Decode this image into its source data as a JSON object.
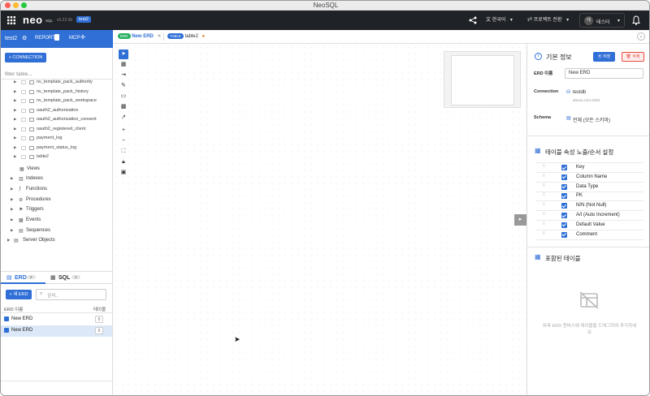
{
  "window": {
    "title": "NeoSQL"
  },
  "appbar": {
    "logo": "neo",
    "logo_sub": "SQL",
    "version": "v0.22.0b",
    "project_badge": "test2",
    "language_label": "한국어",
    "project_switch_label": "프로젝트 전환",
    "avatar_initial": "테",
    "user_name": "테스터"
  },
  "sidebar": {
    "project_name": "test2",
    "report_label": "REPORT",
    "mcp_label": "MCP",
    "connection_button": "CONNECTION",
    "filter_placeholder": "filter table...",
    "tables": [
      "nv_template_pack_authority",
      "nv_template_pack_history",
      "nv_template_pack_workspace",
      "oauth2_authorization",
      "oauth2_authorization_consent",
      "oauth2_registered_client",
      "payment_log",
      "payment_status_log",
      "table2"
    ],
    "groups": [
      "Views",
      "Indexes",
      "Functions",
      "Procedures",
      "Triggers",
      "Events",
      "Sequences"
    ],
    "server_objects": "Server Objects",
    "tabs": {
      "erd_label": "ERD",
      "erd_count": "2",
      "sql_label": "SQL",
      "sql_count": "1"
    },
    "new_erd_button": "+ 새 ERD",
    "search_placeholder": "검색...",
    "list_header": {
      "name": "ERD 이름",
      "tables": "테이블"
    },
    "erd_list": [
      {
        "name": "New ERD",
        "tables": "0"
      },
      {
        "name": "New ERD",
        "tables": "0"
      }
    ]
  },
  "main": {
    "tabs": [
      {
        "badge": "ERD",
        "label": "New ERD",
        "badge_color": "#27ae60"
      },
      {
        "badge": "TABLE",
        "label": "table2",
        "badge_color": "#2f6fd6"
      }
    ]
  },
  "panel": {
    "basic_info_title": "기본 정보",
    "save_button": "저장",
    "delete_button": "삭제",
    "erd_name_label": "ERD 이름",
    "erd_name_value": "New ERD",
    "connection_label": "Connection",
    "connection_name": "testdb",
    "connection_host": "ahnus.com:3360",
    "schema_label": "Schema",
    "schema_value": "전체 (모든 스키마)",
    "attr_title": "테이블 속성 노출/순서 설정",
    "attributes": [
      "Key",
      "Column Name",
      "Data Type",
      "PK",
      "N/N (Not Null)",
      "A/I (Auto Increment)",
      "Default Value",
      "Comment"
    ],
    "included_title": "포함된 테이블",
    "empty_hint_line1": "좌측 ERD 캔버스에 테이블을 드래그하여 추가하세",
    "empty_hint_line2": "요"
  },
  "colors": {
    "accent": "#2f6fd6",
    "appbar": "#1f2226",
    "erd_badge": "#27ae60",
    "delete": "#e74c3c"
  }
}
